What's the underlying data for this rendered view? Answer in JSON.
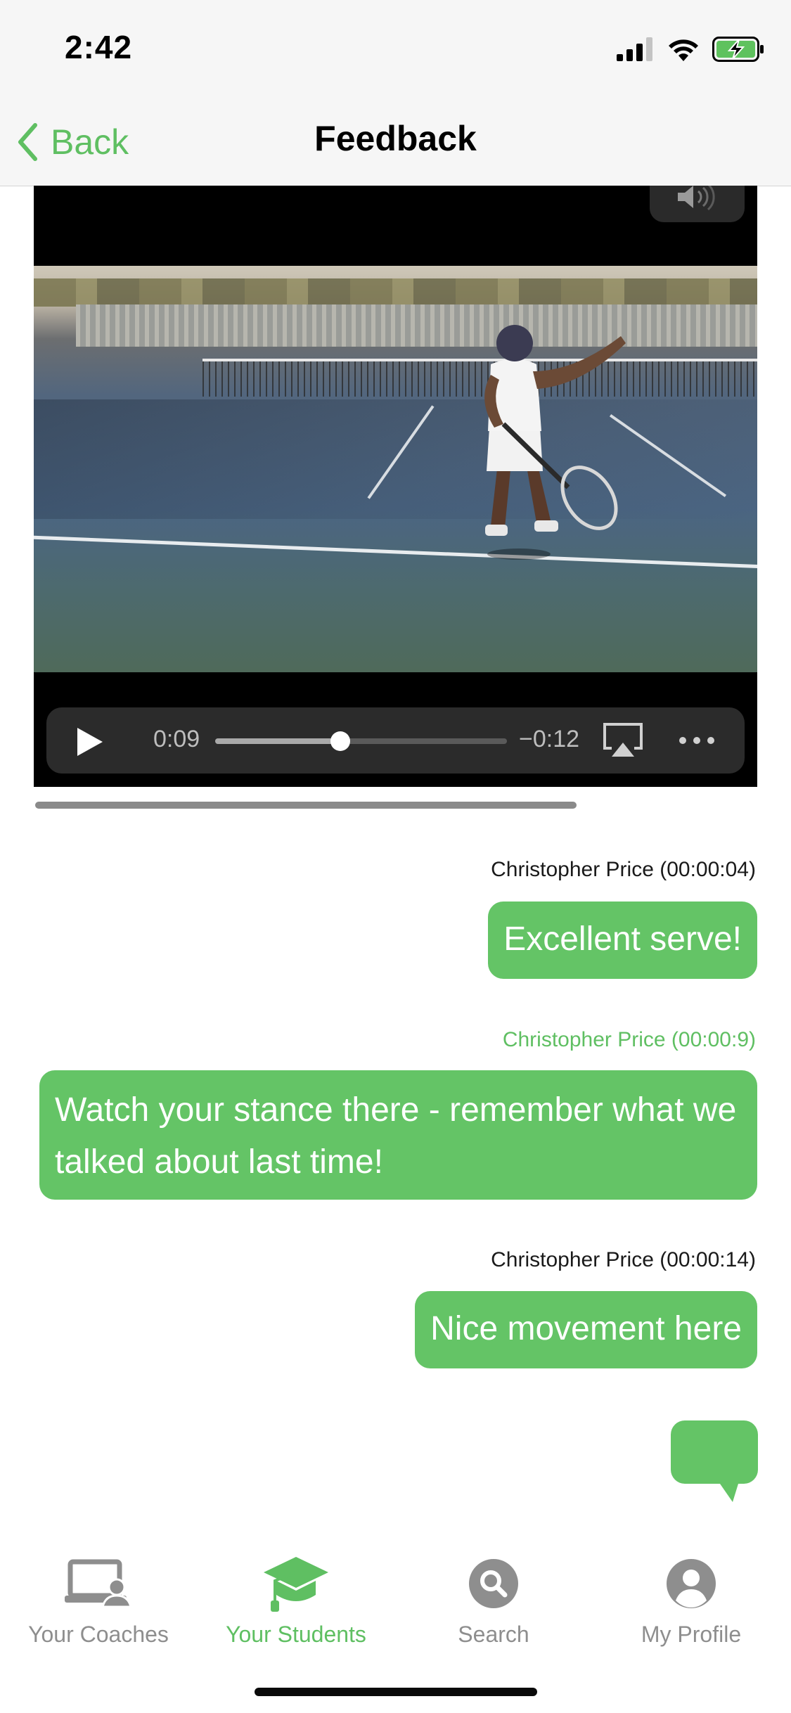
{
  "status_bar": {
    "time": "2:42"
  },
  "nav": {
    "back_label": "Back",
    "title": "Feedback"
  },
  "video": {
    "current_time": "0:09",
    "remaining_time": "−0:12",
    "progress_fraction": 0.43
  },
  "comments": [
    {
      "author_time": "Christopher Price (00:00:04)",
      "text": "Excellent serve!"
    },
    {
      "author_time": "Christopher Price (00:00:9)",
      "text": "Watch your stance there - remember what we talked about last time!"
    },
    {
      "author_time": "Christopher Price (00:00:14)",
      "text": "Nice movement here"
    }
  ],
  "tabs": [
    {
      "label": "Your Coaches",
      "icon": "laptop-person-icon",
      "active": false
    },
    {
      "label": "Your Students",
      "icon": "graduation-cap-icon",
      "active": true
    },
    {
      "label": "Search",
      "icon": "search-icon",
      "active": false
    },
    {
      "label": "My Profile",
      "icon": "profile-icon",
      "active": false
    }
  ],
  "colors": {
    "accent": "#64c466",
    "accent_text": "#5fbf62",
    "inactive": "#8e8e8e"
  }
}
